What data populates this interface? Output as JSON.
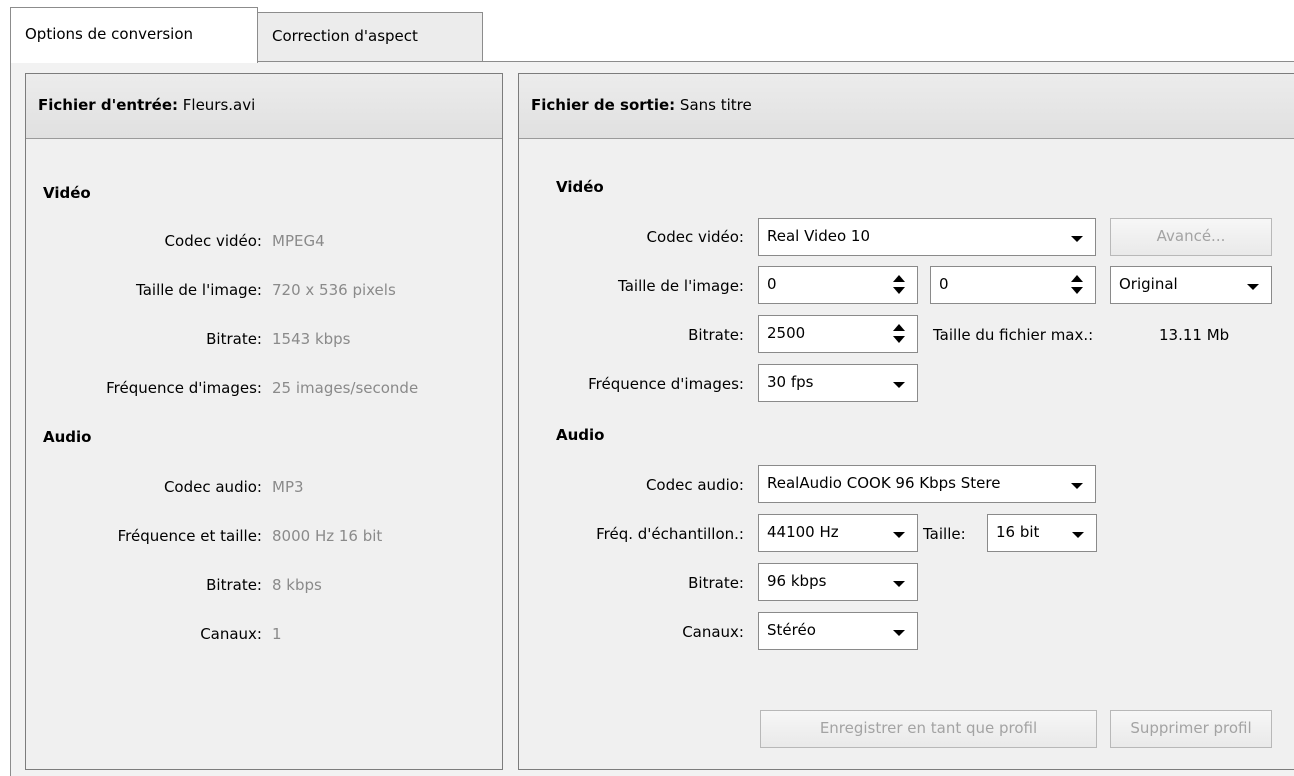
{
  "tabs": [
    {
      "label": "Options de conversion",
      "active": true
    },
    {
      "label": "Correction d'aspect",
      "active": false
    }
  ],
  "input": {
    "header_label": "Fichier d'entrée:",
    "header_value": "Fleurs.avi",
    "video_title": "Vidéo",
    "video_rows": [
      {
        "label": "Codec vidéo:",
        "value": "MPEG4"
      },
      {
        "label": "Taille de l'image:",
        "value": "720 x 536 pixels"
      },
      {
        "label": "Bitrate:",
        "value": "1543 kbps"
      },
      {
        "label": "Fréquence d'images:",
        "value": "25 images/seconde"
      }
    ],
    "audio_title": "Audio",
    "audio_rows": [
      {
        "label": "Codec audio:",
        "value": "MP3"
      },
      {
        "label": "Fréquence et taille:",
        "value": "8000 Hz 16 bit"
      },
      {
        "label": "Bitrate:",
        "value": "8 kbps"
      },
      {
        "label": "Canaux:",
        "value": "1"
      }
    ]
  },
  "output": {
    "header_label": "Fichier de sortie:",
    "header_value": "Sans titre",
    "video_title": "Vidéo",
    "video_codec_label": "Codec vidéo:",
    "video_codec_value": "Real Video 10",
    "advanced_button": "Avancé...",
    "image_size_label": "Taille de l'image:",
    "width_value": "0",
    "height_value": "0",
    "size_preset_value": "Original",
    "bitrate_label": "Bitrate:",
    "bitrate_value": "2500",
    "max_size_label": "Taille du fichier max.:",
    "max_size_value": "13.11 Mb",
    "fps_label": "Fréquence d'images:",
    "fps_value": "30 fps",
    "audio_title": "Audio",
    "audio_codec_label": "Codec audio:",
    "audio_codec_value": "RealAudio COOK 96 Kbps Stere",
    "sample_label": "Fréq. d'échantillon.:",
    "sample_value": "44100 Hz",
    "bits_label": "Taille:",
    "bits_value": "16 bit",
    "audio_bitrate_label": "Bitrate:",
    "audio_bitrate_value": "96 kbps",
    "channels_label": "Canaux:",
    "channels_value": "Stéréo",
    "save_profile_button": "Enregistrer en tant que profil",
    "delete_profile_button": "Supprimer profil"
  }
}
